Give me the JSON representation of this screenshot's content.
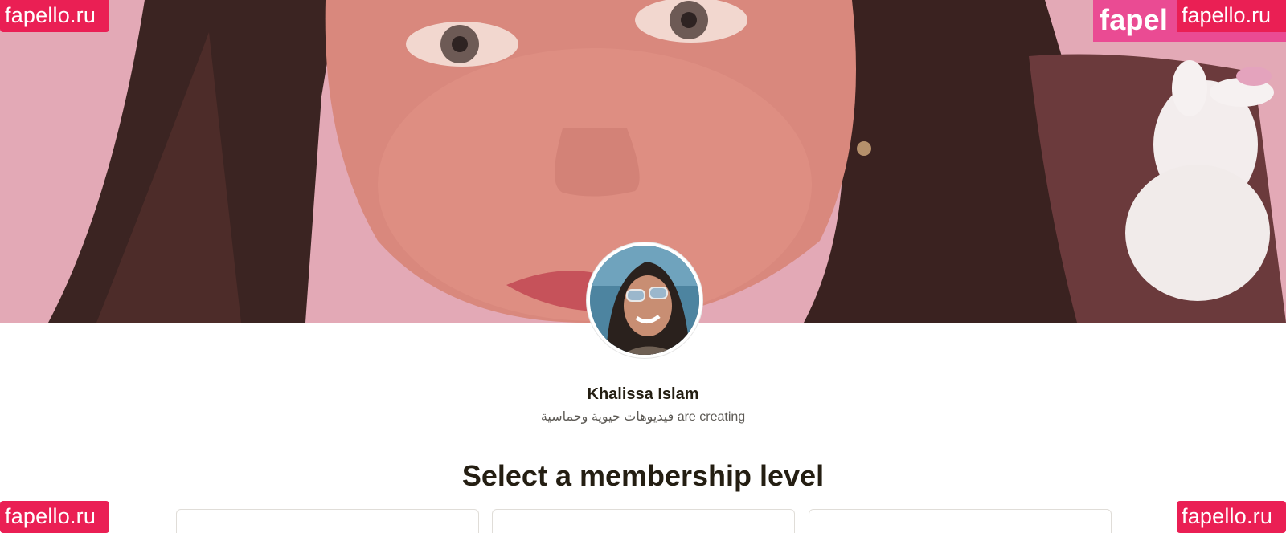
{
  "creator": {
    "name": "Khalissa Islam",
    "tagline": "فيديوهات حيوية وحماسية are creating"
  },
  "membership": {
    "title": "Select a membership level",
    "tier_count_visible": 3
  },
  "watermarks": {
    "top_left": "fapello.ru",
    "top_right_large": "fapel",
    "top_right": "fapello.ru",
    "bottom_left": "fapello.ru",
    "bottom_right": "fapello.ru"
  },
  "colors": {
    "watermark": "#ea1f54",
    "watermark_alt": "#ea4b93",
    "text_primary": "#241e12",
    "text_secondary": "#5d5a55"
  }
}
